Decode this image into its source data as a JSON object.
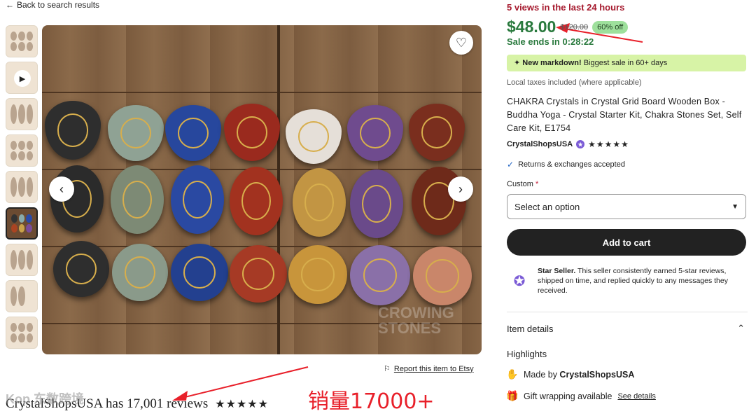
{
  "nav": {
    "back_label": "Back to search results"
  },
  "gallery": {
    "thumbnails": [
      "Product photo 1",
      "Product video",
      "Product photo 3",
      "Product photo 4",
      "Product photo 5",
      "Product photo 6 (selected)",
      "Product photo 7",
      "Product photo 8",
      "Product photo 9"
    ],
    "watermark": "CROWING\nSTONES"
  },
  "report_label": "Report this item to Etsy",
  "reviews": {
    "text": "CrystalShopsUSA has 17,001 reviews",
    "stars": "★★★★★",
    "rating": 5
  },
  "overlay": {
    "watermark": "Kop 东数跨境",
    "sales_note": "销量17000+"
  },
  "listing": {
    "views": "5 views in the last 24 hours",
    "price": "$48.00",
    "original_price": "$120.00",
    "discount": "60% off",
    "sale_ends": "Sale ends in 0:28:22",
    "markdown_bold": "New markdown!",
    "markdown_rest": " Biggest sale in 60+ days",
    "taxes": "Local taxes included (where applicable)",
    "title": "CHAKRA Crystals in Crystal Grid Board Wooden Box - Buddha Yoga - Crystal Starter Kit, Chakra Stones Set, Self Care Kit, E1754",
    "shop_name": "CrystalShopsUSA",
    "shop_stars": "★★★★★",
    "returns": "Returns & exchanges accepted",
    "custom_label": "Custom",
    "custom_required": "*",
    "select_placeholder": "Select an option",
    "add_to_cart": "Add to cart",
    "star_seller_bold": "Star Seller.",
    "star_seller_text": " This seller consistently earned 5-star reviews, shipped on time, and replied quickly to any messages they received.",
    "item_details": "Item details",
    "highlights": "Highlights",
    "made_by_prefix": "Made by ",
    "made_by_shop": "CrystalShopsUSA",
    "gift_wrapping": "Gift wrapping available",
    "see_details": "See details"
  },
  "colors": {
    "price_green": "#2a7a3e",
    "views_red": "#a61a2e",
    "markdown_bg": "#d7f3a6",
    "star_seller_purple": "#7b5bd6",
    "annotation_red": "#e8202a"
  }
}
